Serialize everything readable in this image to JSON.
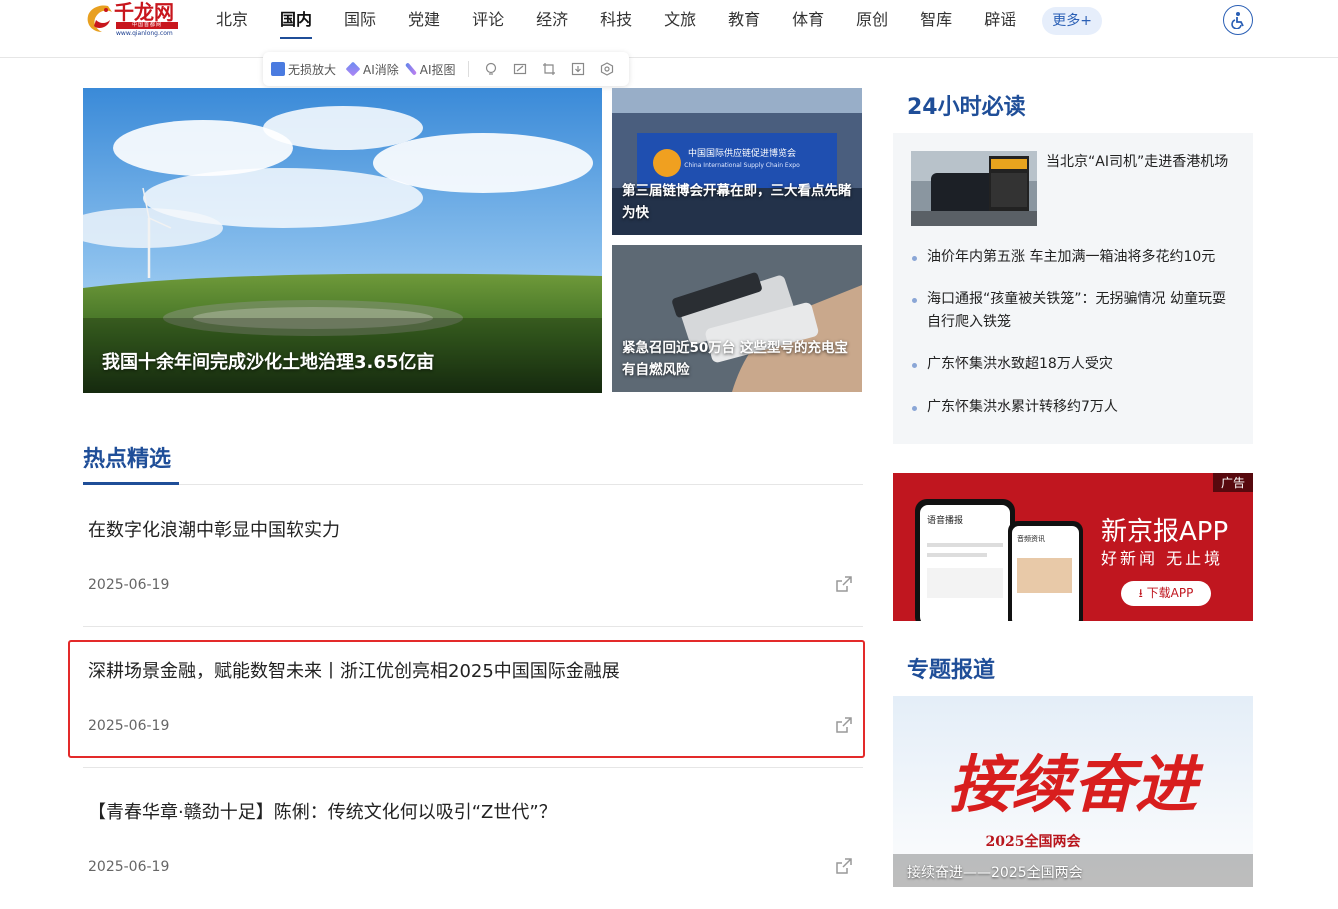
{
  "logo": {
    "name": "千龙网",
    "strip": "中国首都网",
    "url": "www.qianlong.com"
  },
  "nav": {
    "items": [
      "北京",
      "国内",
      "国际",
      "党建",
      "评论",
      "经济",
      "科技",
      "文旅",
      "教育",
      "体育",
      "原创",
      "智库",
      "辟谣"
    ],
    "active": "国内",
    "more": "更多+"
  },
  "ai_toolbar": {
    "lossless": "无损放大",
    "erase": "AI消除",
    "cutout": "AI抠图"
  },
  "hero": {
    "main_caption": "我国十余年间完成沙化土地治理3.65亿亩",
    "side1_caption": "第三届链博会开幕在即，三大看点先睹为快",
    "side2_caption": "紧急召回近50万台 这些型号的充电宝有自燃风险",
    "side1_sign": "中国国际供应链促进博览会",
    "side1_sign_en": "China International Supply Chain Expo"
  },
  "hot": {
    "title": "热点精选",
    "articles": [
      {
        "title": "在数字化浪潮中彰显中国软实力",
        "date": "2025-06-19"
      },
      {
        "title": "深耕场景金融，赋能数智未来丨浙江优创亮相2025中国国际金融展",
        "date": "2025-06-19"
      },
      {
        "title": "【青春华章·赣劲十足】陈俐：传统文化何以吸引“Z世代”？",
        "date": "2025-06-19"
      }
    ]
  },
  "read24": {
    "title": "24小时必读",
    "top": "当北京“AI司机”走进香港机场",
    "items": [
      "油价年内第五涨 车主加满一箱油将多花约10元",
      "海口通报“孩童被关铁笼”：无拐骗情况 幼童玩耍自行爬入铁笼",
      "广东怀集洪水致超18万人受灾",
      "广东怀集洪水累计转移约7万人"
    ]
  },
  "ad": {
    "tag": "广告",
    "name": "新京报APP",
    "slogan": "好新闻 无止境",
    "button": "下载APP",
    "phone1_title": "语音播报",
    "phone2_title": "音频资讯"
  },
  "special": {
    "title": "专题报道",
    "caption": "接续奋进——2025全国两会",
    "banner_text": "接续奋进",
    "banner_sub": "2025全国两会"
  }
}
